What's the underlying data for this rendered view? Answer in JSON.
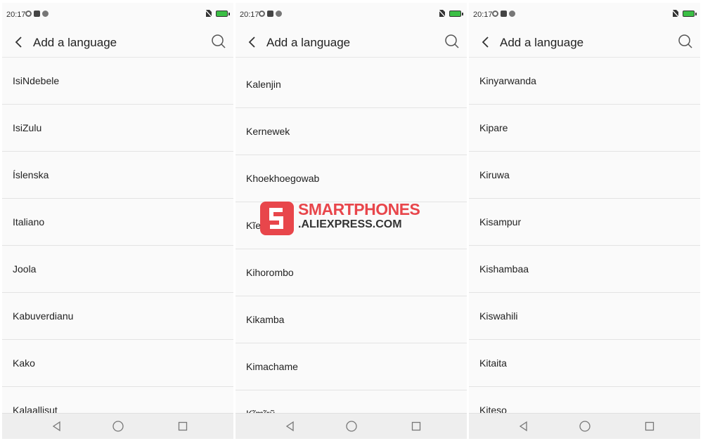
{
  "status": {
    "time": "20:17"
  },
  "screens": [
    {
      "title": "Add a language",
      "items": [
        "IsiNdebele",
        "IsiZulu",
        "Íslenska",
        "Italiano",
        "Joola",
        "Kabuverdianu",
        "Kako",
        "Kalaallisut"
      ]
    },
    {
      "title": "Add a language",
      "items": [
        "Kalenjin",
        "Kernewek",
        "Khoekhoegowab",
        "Kĩembu",
        "Kihorombo",
        "Kikamba",
        "Kimachame",
        "Kĩmĩrũ"
      ]
    },
    {
      "title": "Add a language",
      "items": [
        "Kinyarwanda",
        "Kipare",
        "Kiruwa",
        "Kisampur",
        "Kishambaa",
        "Kiswahili",
        "Kitaita",
        "Kiteso"
      ]
    }
  ],
  "watermark": {
    "line1": "SMARTPHONES",
    "line2": ".ALIEXPRESS.COM"
  },
  "colors": {
    "battery": "#3bbf45",
    "watermark_red": "#e8464b"
  }
}
